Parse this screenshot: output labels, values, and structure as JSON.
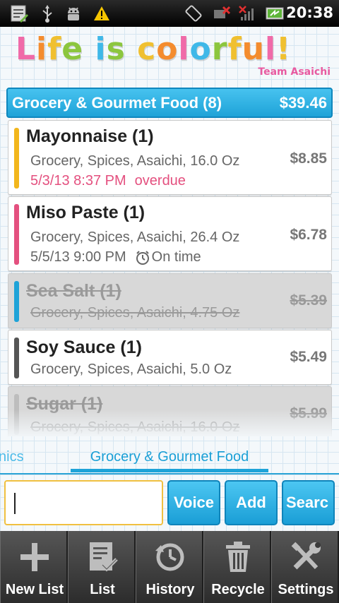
{
  "status_bar": {
    "time": "20:38",
    "icons": [
      "notes-icon",
      "usb-icon",
      "android-debug-icon",
      "warning-icon",
      "rotate-icon",
      "signal-off-icon",
      "no-signal-icon",
      "battery-icon"
    ]
  },
  "logo": {
    "title_letters": [
      {
        "ch": "L",
        "color": "#f06aa8"
      },
      {
        "ch": "i",
        "color": "#f48c2e"
      },
      {
        "ch": "f",
        "color": "#f0c030"
      },
      {
        "ch": "e",
        "color": "#8cc63e"
      },
      {
        "ch": " ",
        "color": "#ffffff"
      },
      {
        "ch": "i",
        "color": "#3fb8e8"
      },
      {
        "ch": "s",
        "color": "#8cc63e"
      },
      {
        "ch": " ",
        "color": "#ffffff"
      },
      {
        "ch": "c",
        "color": "#f0c030"
      },
      {
        "ch": "o",
        "color": "#f48c2e"
      },
      {
        "ch": "l",
        "color": "#f06aa8"
      },
      {
        "ch": "o",
        "color": "#3fb8e8"
      },
      {
        "ch": "r",
        "color": "#8cc63e"
      },
      {
        "ch": "f",
        "color": "#f0c030"
      },
      {
        "ch": "u",
        "color": "#f48c2e"
      },
      {
        "ch": "l",
        "color": "#f06aa8"
      },
      {
        "ch": "!",
        "color": "#f0c030"
      }
    ],
    "subtitle": "Team Asaichi"
  },
  "category": {
    "title": "Grocery & Gourmet Food (8)",
    "total": "$39.46"
  },
  "items": [
    {
      "name": "Mayonnaise (1)",
      "details": "Grocery, Spices, Asaichi, 16.0 Oz",
      "price": "$8.85",
      "due_date": "5/3/13 8:37 PM",
      "due_status": "overdue",
      "color": "#f2b61c",
      "done": false
    },
    {
      "name": "Miso Paste (1)",
      "details": "Grocery, Spices, Asaichi, 26.4 Oz",
      "price": "$6.78",
      "due_date": "5/5/13 9:00 PM",
      "due_status": "On time",
      "color": "#e4507f",
      "done": false
    },
    {
      "name": "Sea Salt (1)",
      "details": "Grocery, Spices, Asaichi, 4.75 Oz",
      "price": "$5.39",
      "color": "#1ea3d8",
      "done": true
    },
    {
      "name": "Soy Sauce (1)",
      "details": "Grocery, Spices, Asaichi, 5.0 Oz",
      "price": "$5.49",
      "color": "#555555",
      "done": false
    },
    {
      "name": "Sugar (1)",
      "details": "Grocery, Spices, Asaichi, 16.0 Oz",
      "price": "$5.99",
      "color": "#bdbdbd",
      "done": true
    }
  ],
  "colors": {
    "overdue": "#e4507f",
    "ontime": "#666666",
    "accent": "#1ea3d8"
  },
  "tabs": {
    "previous_partial": "nics",
    "active": "Grocery & Gourmet Food"
  },
  "input": {
    "value": "",
    "placeholder": ""
  },
  "buttons": {
    "voice": "Voice",
    "add": "Add",
    "search": "Searc"
  },
  "toolbar": [
    {
      "label": "New List",
      "icon": "plus-icon"
    },
    {
      "label": "List",
      "icon": "checklist-icon"
    },
    {
      "label": "History",
      "icon": "history-icon"
    },
    {
      "label": "Recycle",
      "icon": "trash-icon"
    },
    {
      "label": "Settings",
      "icon": "tools-icon"
    }
  ]
}
